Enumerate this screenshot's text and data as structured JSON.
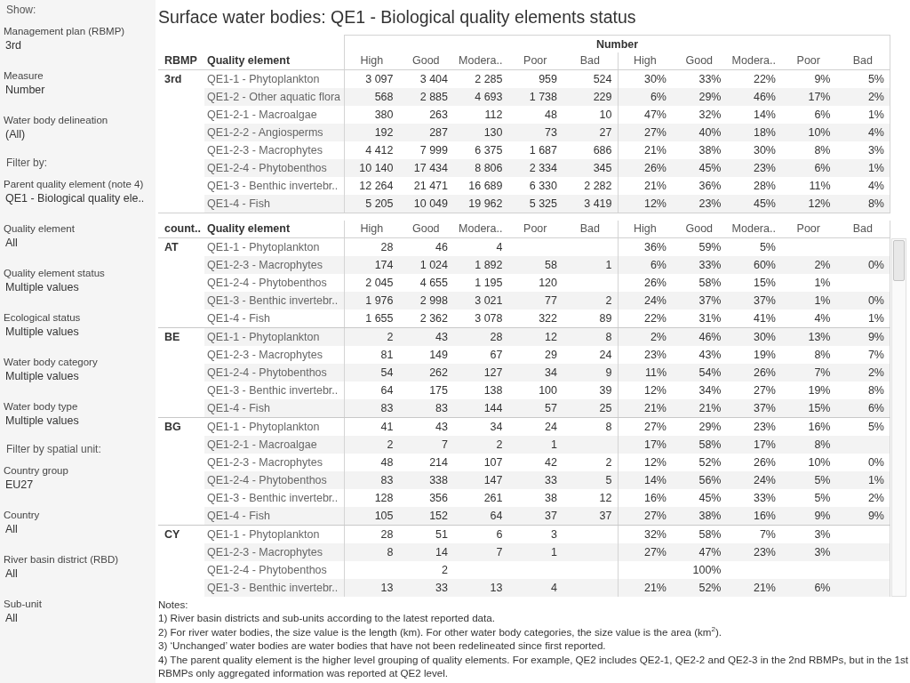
{
  "sidebar": {
    "sections": [
      {
        "heading": "Show:",
        "filters": [
          {
            "label": "Management plan (RBMP)",
            "value": "3rd"
          },
          {
            "label": "Measure",
            "value": "Number"
          },
          {
            "label": "Water body delineation",
            "value": "(All)"
          }
        ]
      },
      {
        "heading": "Filter by:",
        "filters": [
          {
            "label": "Parent quality element (note 4)",
            "value": "QE1 - Biological quality ele.."
          },
          {
            "label": "Quality element",
            "value": "All"
          },
          {
            "label": "Quality element status",
            "value": "Multiple values"
          },
          {
            "label": "Ecological status",
            "value": "Multiple values"
          },
          {
            "label": "Water body category",
            "value": "Multiple values"
          },
          {
            "label": "Water body type",
            "value": "Multiple values"
          }
        ]
      },
      {
        "heading": "Filter by spatial unit:",
        "filters": [
          {
            "label": "Country group",
            "value": "EU27"
          },
          {
            "label": "Country",
            "value": "All"
          },
          {
            "label": "River basin district (RBD)",
            "value": "All"
          },
          {
            "label": "Sub-unit",
            "value": "All"
          }
        ]
      }
    ]
  },
  "title": "Surface water bodies: QE1 - Biological quality elements status",
  "summary_table": {
    "measure": "Number",
    "row_headers": [
      "RBMP",
      "Quality element"
    ],
    "count_headers": [
      "High",
      "Good",
      "Modera..",
      "Poor",
      "Bad"
    ],
    "share_headers": [
      "High",
      "Good",
      "Modera..",
      "Poor",
      "Bad"
    ],
    "groups": [
      {
        "label": "3rd",
        "rows": [
          {
            "element": "QE1-1 - Phytoplankton",
            "counts": {
              "high": "3 097",
              "good": "3 404",
              "moderate": "2 285",
              "poor": "959",
              "bad": "524"
            },
            "shares": {
              "high": "30%",
              "good": "33%",
              "moderate": "22%",
              "poor": "9%",
              "bad": "5%"
            }
          },
          {
            "element": "QE1-2 - Other aquatic flora",
            "counts": {
              "high": "568",
              "good": "2 885",
              "moderate": "4 693",
              "poor": "1 738",
              "bad": "229"
            },
            "shares": {
              "high": "6%",
              "good": "29%",
              "moderate": "46%",
              "poor": "17%",
              "bad": "2%"
            }
          },
          {
            "element": "QE1-2-1 - Macroalgae",
            "counts": {
              "high": "380",
              "good": "263",
              "moderate": "112",
              "poor": "48",
              "bad": "10"
            },
            "shares": {
              "high": "47%",
              "good": "32%",
              "moderate": "14%",
              "poor": "6%",
              "bad": "1%"
            }
          },
          {
            "element": "QE1-2-2 - Angiosperms",
            "counts": {
              "high": "192",
              "good": "287",
              "moderate": "130",
              "poor": "73",
              "bad": "27"
            },
            "shares": {
              "high": "27%",
              "good": "40%",
              "moderate": "18%",
              "poor": "10%",
              "bad": "4%"
            }
          },
          {
            "element": "QE1-2-3 - Macrophytes",
            "counts": {
              "high": "4 412",
              "good": "7 999",
              "moderate": "6 375",
              "poor": "1 687",
              "bad": "686"
            },
            "shares": {
              "high": "21%",
              "good": "38%",
              "moderate": "30%",
              "poor": "8%",
              "bad": "3%"
            }
          },
          {
            "element": "QE1-2-4 - Phytobenthos",
            "counts": {
              "high": "10 140",
              "good": "17 434",
              "moderate": "8 806",
              "poor": "2 334",
              "bad": "345"
            },
            "shares": {
              "high": "26%",
              "good": "45%",
              "moderate": "23%",
              "poor": "6%",
              "bad": "1%"
            }
          },
          {
            "element": "QE1-3 - Benthic invertebr..",
            "counts": {
              "high": "12 264",
              "good": "21 471",
              "moderate": "16 689",
              "poor": "6 330",
              "bad": "2 282"
            },
            "shares": {
              "high": "21%",
              "good": "36%",
              "moderate": "28%",
              "poor": "11%",
              "bad": "4%"
            }
          },
          {
            "element": "QE1-4 - Fish",
            "counts": {
              "high": "5 205",
              "good": "10 049",
              "moderate": "19 962",
              "poor": "5 325",
              "bad": "3 419"
            },
            "shares": {
              "high": "12%",
              "good": "23%",
              "moderate": "45%",
              "poor": "12%",
              "bad": "8%"
            }
          }
        ]
      }
    ]
  },
  "country_table": {
    "row_headers": [
      "count..",
      "Quality element"
    ],
    "count_headers": [
      "High",
      "Good",
      "Modera..",
      "Poor",
      "Bad"
    ],
    "share_headers": [
      "High",
      "Good",
      "Modera..",
      "Poor",
      "Bad"
    ],
    "groups": [
      {
        "label": "AT",
        "rows": [
          {
            "element": "QE1-1 - Phytoplankton",
            "counts": {
              "high": "28",
              "good": "46",
              "moderate": "4"
            },
            "shares": {
              "high": "36%",
              "good": "59%",
              "moderate": "5%"
            }
          },
          {
            "element": "QE1-2-3 - Macrophytes",
            "counts": {
              "high": "174",
              "good": "1 024",
              "moderate": "1 892",
              "poor": "58",
              "bad": "1"
            },
            "shares": {
              "high": "6%",
              "good": "33%",
              "moderate": "60%",
              "poor": "2%",
              "bad": "0%"
            }
          },
          {
            "element": "QE1-2-4 - Phytobenthos",
            "counts": {
              "high": "2 045",
              "good": "4 655",
              "moderate": "1 195",
              "poor": "120"
            },
            "shares": {
              "high": "26%",
              "good": "58%",
              "moderate": "15%",
              "poor": "1%"
            }
          },
          {
            "element": "QE1-3 - Benthic invertebr..",
            "counts": {
              "high": "1 976",
              "good": "2 998",
              "moderate": "3 021",
              "poor": "77",
              "bad": "2"
            },
            "shares": {
              "high": "24%",
              "good": "37%",
              "moderate": "37%",
              "poor": "1%",
              "bad": "0%"
            }
          },
          {
            "element": "QE1-4 - Fish",
            "counts": {
              "high": "1 655",
              "good": "2 362",
              "moderate": "3 078",
              "poor": "322",
              "bad": "89"
            },
            "shares": {
              "high": "22%",
              "good": "31%",
              "moderate": "41%",
              "poor": "4%",
              "bad": "1%"
            }
          }
        ]
      },
      {
        "label": "BE",
        "rows": [
          {
            "element": "QE1-1 - Phytoplankton",
            "counts": {
              "high": "2",
              "good": "43",
              "moderate": "28",
              "poor": "12",
              "bad": "8"
            },
            "shares": {
              "high": "2%",
              "good": "46%",
              "moderate": "30%",
              "poor": "13%",
              "bad": "9%"
            }
          },
          {
            "element": "QE1-2-3 - Macrophytes",
            "counts": {
              "high": "81",
              "good": "149",
              "moderate": "67",
              "poor": "29",
              "bad": "24"
            },
            "shares": {
              "high": "23%",
              "good": "43%",
              "moderate": "19%",
              "poor": "8%",
              "bad": "7%"
            }
          },
          {
            "element": "QE1-2-4 - Phytobenthos",
            "counts": {
              "high": "54",
              "good": "262",
              "moderate": "127",
              "poor": "34",
              "bad": "9"
            },
            "shares": {
              "high": "11%",
              "good": "54%",
              "moderate": "26%",
              "poor": "7%",
              "bad": "2%"
            }
          },
          {
            "element": "QE1-3 - Benthic invertebr..",
            "counts": {
              "high": "64",
              "good": "175",
              "moderate": "138",
              "poor": "100",
              "bad": "39"
            },
            "shares": {
              "high": "12%",
              "good": "34%",
              "moderate": "27%",
              "poor": "19%",
              "bad": "8%"
            }
          },
          {
            "element": "QE1-4 - Fish",
            "counts": {
              "high": "83",
              "good": "83",
              "moderate": "144",
              "poor": "57",
              "bad": "25"
            },
            "shares": {
              "high": "21%",
              "good": "21%",
              "moderate": "37%",
              "poor": "15%",
              "bad": "6%"
            }
          }
        ]
      },
      {
        "label": "BG",
        "rows": [
          {
            "element": "QE1-1 - Phytoplankton",
            "counts": {
              "high": "41",
              "good": "43",
              "moderate": "34",
              "poor": "24",
              "bad": "8"
            },
            "shares": {
              "high": "27%",
              "good": "29%",
              "moderate": "23%",
              "poor": "16%",
              "bad": "5%"
            }
          },
          {
            "element": "QE1-2-1 - Macroalgae",
            "counts": {
              "high": "2",
              "good": "7",
              "moderate": "2",
              "poor": "1"
            },
            "shares": {
              "high": "17%",
              "good": "58%",
              "moderate": "17%",
              "poor": "8%"
            }
          },
          {
            "element": "QE1-2-3 - Macrophytes",
            "counts": {
              "high": "48",
              "good": "214",
              "moderate": "107",
              "poor": "42",
              "bad": "2"
            },
            "shares": {
              "high": "12%",
              "good": "52%",
              "moderate": "26%",
              "poor": "10%",
              "bad": "0%"
            }
          },
          {
            "element": "QE1-2-4 - Phytobenthos",
            "counts": {
              "high": "83",
              "good": "338",
              "moderate": "147",
              "poor": "33",
              "bad": "5"
            },
            "shares": {
              "high": "14%",
              "good": "56%",
              "moderate": "24%",
              "poor": "5%",
              "bad": "1%"
            }
          },
          {
            "element": "QE1-3 - Benthic invertebr..",
            "counts": {
              "high": "128",
              "good": "356",
              "moderate": "261",
              "poor": "38",
              "bad": "12"
            },
            "shares": {
              "high": "16%",
              "good": "45%",
              "moderate": "33%",
              "poor": "5%",
              "bad": "2%"
            }
          },
          {
            "element": "QE1-4 - Fish",
            "counts": {
              "high": "105",
              "good": "152",
              "moderate": "64",
              "poor": "37",
              "bad": "37"
            },
            "shares": {
              "high": "27%",
              "good": "38%",
              "moderate": "16%",
              "poor": "9%",
              "bad": "9%"
            }
          }
        ]
      },
      {
        "label": "CY",
        "rows": [
          {
            "element": "QE1-1 - Phytoplankton",
            "counts": {
              "high": "28",
              "good": "51",
              "moderate": "6",
              "poor": "3"
            },
            "shares": {
              "high": "32%",
              "good": "58%",
              "moderate": "7%",
              "poor": "3%"
            }
          },
          {
            "element": "QE1-2-3 - Macrophytes",
            "counts": {
              "high": "8",
              "good": "14",
              "moderate": "7",
              "poor": "1"
            },
            "shares": {
              "high": "27%",
              "good": "47%",
              "moderate": "23%",
              "poor": "3%"
            }
          },
          {
            "element": "QE1-2-4 - Phytobenthos",
            "counts": {
              "good": "2"
            },
            "shares": {
              "good": "100%"
            }
          },
          {
            "element": "QE1-3 - Benthic invertebr..",
            "counts": {
              "high": "13",
              "good": "33",
              "moderate": "13",
              "poor": "4"
            },
            "shares": {
              "high": "21%",
              "good": "52%",
              "moderate": "21%",
              "poor": "6%"
            }
          }
        ]
      }
    ]
  },
  "notes": {
    "heading": "Notes:",
    "items": [
      "1) River basin districts and sub-units according to the latest reported data.",
      "2) For river water bodies, the size value is the length (km). For other water body categories, the size value is the area (km$^{2}$).",
      "3) ‘Unchanged’ water bodies are water bodies that have not been redelineated since first reported.",
      "4) The parent quality element is the higher level grouping of quality elements. For example, QE2 includes QE2-1, QE2-2 and QE2-3 in the 2nd RBMPs, but in the 1st RBMPs only aggregated information was reported at QE2 level."
    ]
  }
}
